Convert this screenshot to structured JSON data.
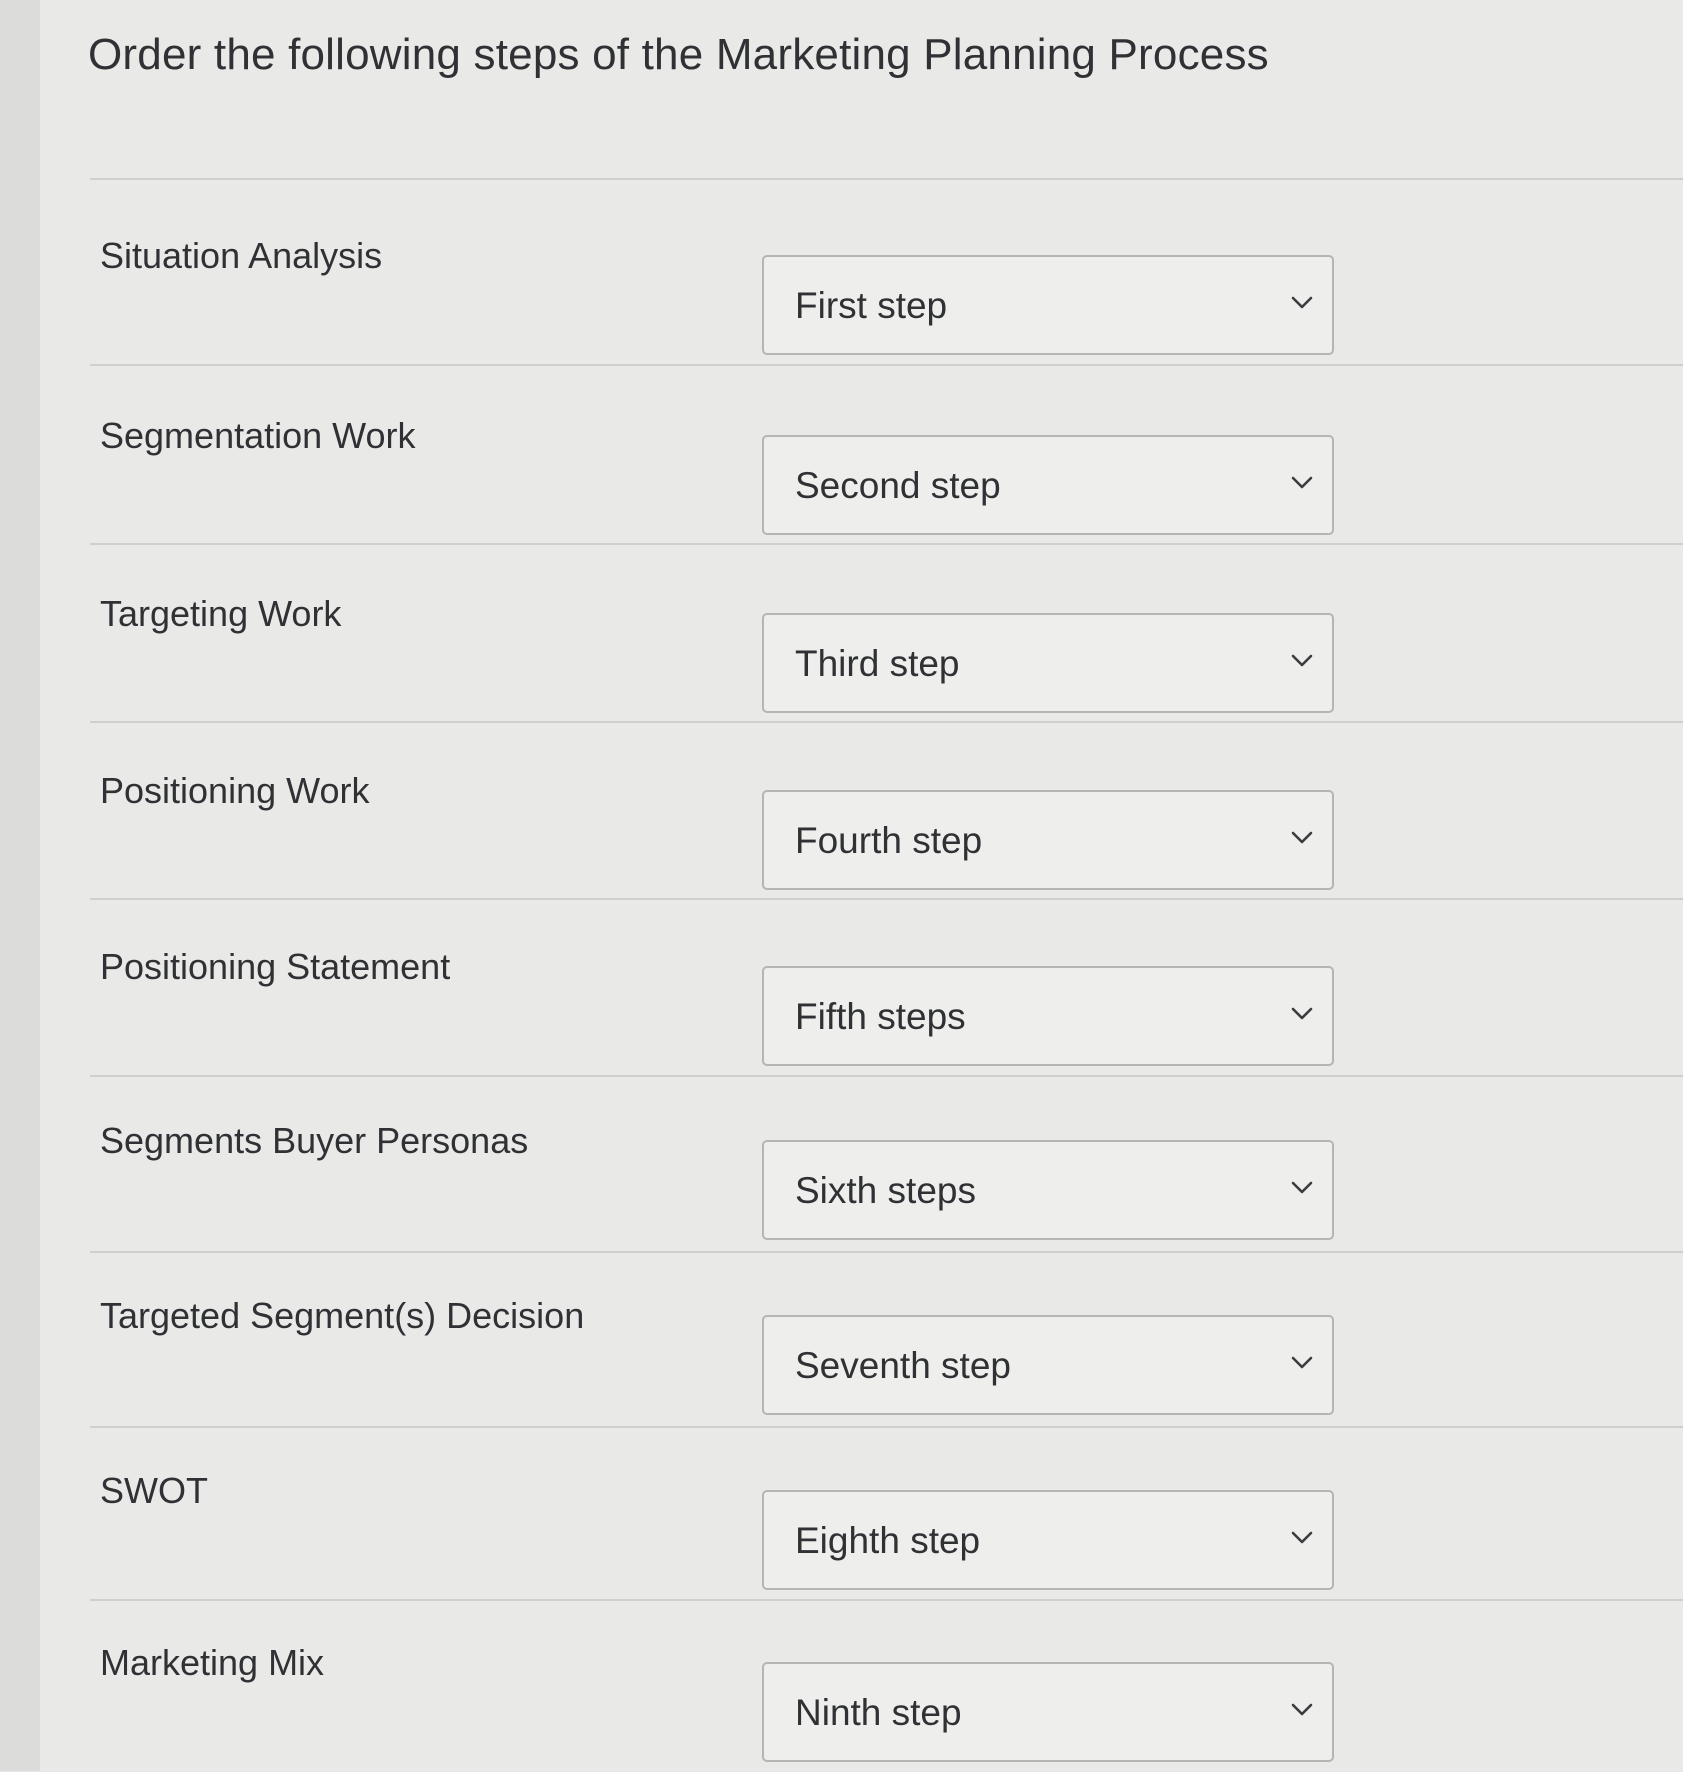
{
  "question": {
    "title": "Order the following steps of the Marketing Planning Process"
  },
  "rows": [
    {
      "label": "Situation Analysis",
      "selected": "First step"
    },
    {
      "label": "Segmentation Work",
      "selected": "Second step"
    },
    {
      "label": "Targeting Work",
      "selected": "Third step"
    },
    {
      "label": "Positioning Work",
      "selected": "Fourth step"
    },
    {
      "label": "Positioning Statement",
      "selected": "Fifth steps"
    },
    {
      "label": "Segments Buyer Personas",
      "selected": "Sixth steps"
    },
    {
      "label": "Targeted Segment(s) Decision",
      "selected": "Seventh step"
    },
    {
      "label": "SWOT",
      "selected": "Eighth step"
    },
    {
      "label": "Marketing Mix",
      "selected": "Ninth step"
    }
  ],
  "icons": {
    "dropdown": "chevron-down-icon"
  },
  "colors": {
    "background": "#e9e9e7",
    "text": "#2f3135",
    "border": "#b5b5b3"
  }
}
